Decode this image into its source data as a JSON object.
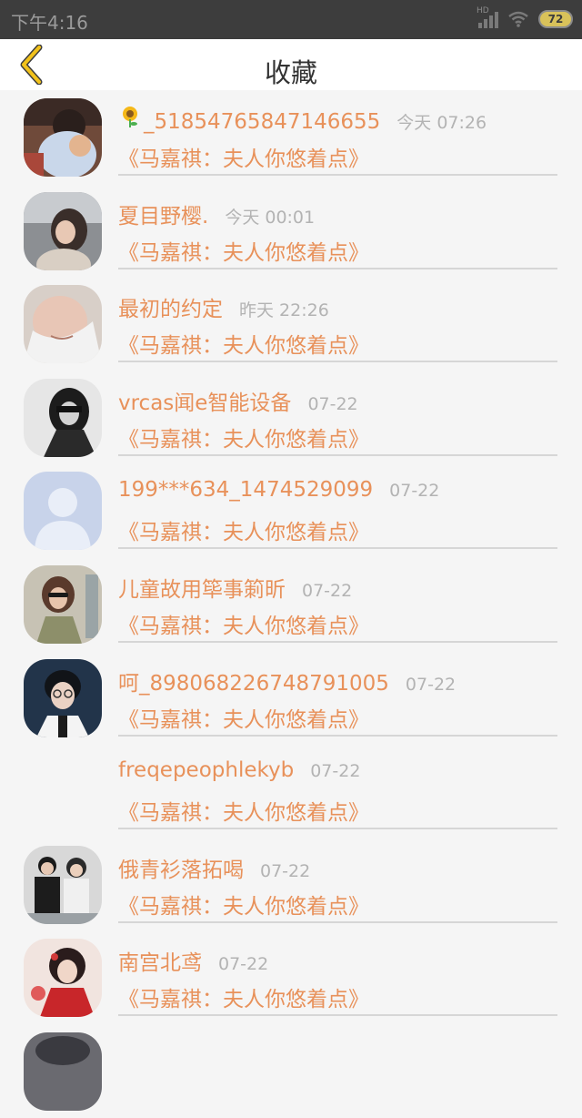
{
  "status_bar": {
    "time": "下午4:16",
    "network": "HD",
    "battery": "72"
  },
  "header": {
    "title": "收藏",
    "back_icon": "chevron-left-icon"
  },
  "colors": {
    "accent": "#e8915a",
    "back_icon": "#f2c21b",
    "time": "#b3b3b3",
    "divider": "#d6d6d6"
  },
  "items": [
    {
      "name": "_51854765847146655",
      "name_prefix_icon": "sunflower-icon",
      "time": "今天 07:26",
      "book": "《马嘉祺：夫人你悠着点》",
      "avatar": "photo"
    },
    {
      "name": "夏目野樱.",
      "time": "今天 00:01",
      "book": "《马嘉祺：夫人你悠着点》",
      "avatar": "photo"
    },
    {
      "name": "最初的约定",
      "time": "昨天 22:26",
      "book": "《马嘉祺：夫人你悠着点》",
      "avatar": "photo"
    },
    {
      "name": "vrcas闻e智能设备",
      "time": "07-22",
      "book": "《马嘉祺：夫人你悠着点》",
      "avatar": "photo"
    },
    {
      "name": "199***634_1474529099",
      "time": "07-22",
      "book": "《马嘉祺：夫人你悠着点》",
      "avatar": "default-avatar"
    },
    {
      "name": "儿童故用筚事箣昕",
      "time": "07-22",
      "book": "《马嘉祺：夫人你悠着点》",
      "avatar": "photo"
    },
    {
      "name": "呵_898068226748791005",
      "time": "07-22",
      "book": "《马嘉祺：夫人你悠着点》",
      "avatar": "photo"
    },
    {
      "name": "freqepeophlekyb",
      "time": "07-22",
      "book": "《马嘉祺：夫人你悠着点》",
      "avatar": "none"
    },
    {
      "name": "俄青衫落拓喝",
      "time": "07-22",
      "book": "《马嘉祺：夫人你悠着点》",
      "avatar": "photo"
    },
    {
      "name": "南宫北鸢",
      "time": "07-22",
      "book": "《马嘉祺：夫人你悠着点》",
      "avatar": "photo"
    }
  ]
}
